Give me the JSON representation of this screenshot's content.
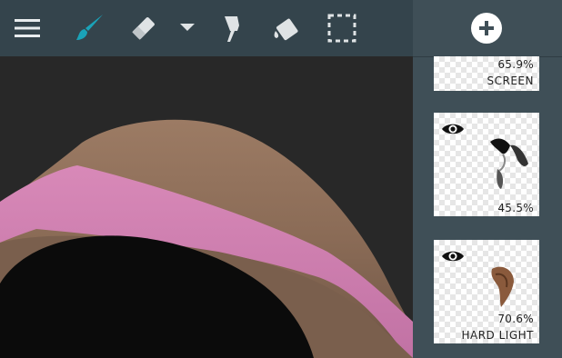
{
  "toolbar": {
    "menu_icon": "menu-icon",
    "tools": [
      "brush-icon",
      "eraser-icon",
      "dropdown-arrow-icon",
      "smudge-icon",
      "fill-icon",
      "selection-icon"
    ],
    "active_color": "#1aa3b8"
  },
  "layers_panel": {
    "add_icon": "plus-icon",
    "layers": [
      {
        "opacity": "65.9%",
        "blend_mode": "SCREEN"
      },
      {
        "opacity": "45.5%",
        "blend_mode": ""
      },
      {
        "opacity": "70.6%",
        "blend_mode": "HARD LIGHT"
      }
    ]
  }
}
